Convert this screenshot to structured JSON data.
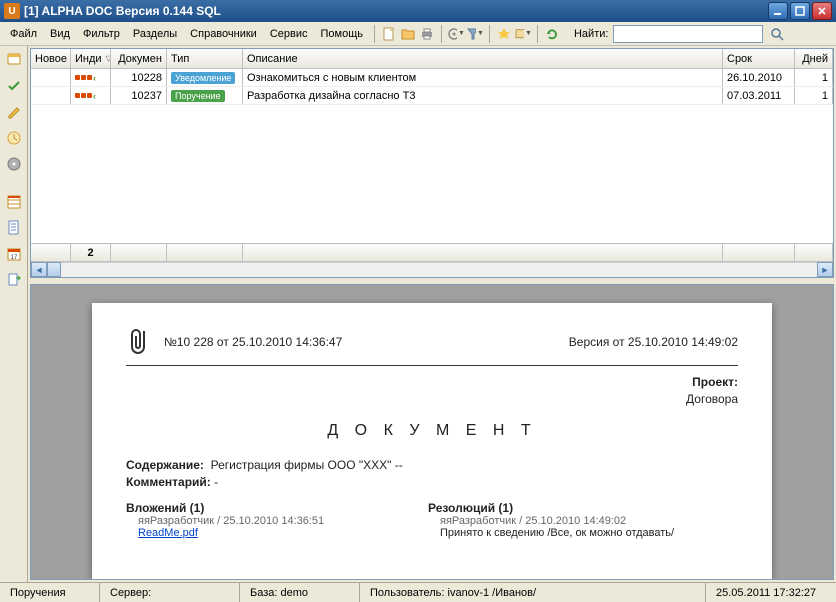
{
  "window": {
    "title": "[1] ALPHA DOC Версия 0.144 SQL"
  },
  "menu": {
    "items": [
      "Файл",
      "Вид",
      "Фильтр",
      "Разделы",
      "Справочники",
      "Сервис",
      "Помощь"
    ]
  },
  "toolbar": {
    "search_label": "Найти:",
    "search_value": ""
  },
  "grid": {
    "columns": {
      "novoe": "Новое",
      "indi": "Инди",
      "docn": "Докумен",
      "type": "Тип",
      "desc": "Описание",
      "srok": "Срок",
      "dney": "Дней"
    },
    "rows": [
      {
        "docn": "10228",
        "type": "Уведомление",
        "type_class": "uv",
        "desc": "Ознакомиться с новым клиентом",
        "srok": "26.10.2010",
        "dney": "1"
      },
      {
        "docn": "10237",
        "type": "Поручение",
        "type_class": "po",
        "desc": "Разработка дизайна согласно Т3",
        "srok": "07.03.2011",
        "dney": "1"
      }
    ],
    "footer_count": "2"
  },
  "document": {
    "header_left": "№10 228 от 25.10.2010 14:36:47",
    "header_right": "Версия от 25.10.2010 14:49:02",
    "project_label": "Проект:",
    "project_value": "Договора",
    "title": "Д О К У М Е Н Т",
    "content_label": "Содержание:",
    "content_value": "Регистрация фирмы ООО \"ХХХ\" --",
    "comment_label": "Комментарий:",
    "comment_value": "-",
    "attachments": {
      "label": "Вложений (1)",
      "by": "яяРазработчик / 25.10.2010 14:36:51",
      "file": "ReadMe.pdf"
    },
    "resolutions": {
      "label": "Резолюций (1)",
      "by": "яяРазработчик / 25.10.2010 14:49:02",
      "text": "Принято к сведению /Все, ок можно отдавать/"
    }
  },
  "status": {
    "section": "Поручения",
    "server_label": "Сервер:",
    "server_value": "",
    "base_label": "База:",
    "base_value": "demo",
    "user_label": "Пользователь:",
    "user_value": "ivanov-1 /Иванов/",
    "datetime": "25.05.2011 17:32:27"
  }
}
